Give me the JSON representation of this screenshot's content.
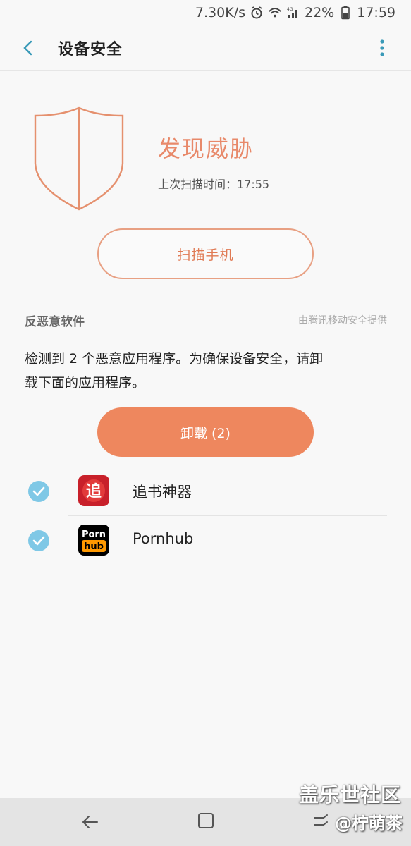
{
  "status_bar": {
    "speed": "7.30K/s",
    "battery": "22%",
    "time": "17:59",
    "icons": [
      "alarm-icon",
      "wifi-icon",
      "signal-4g-icon",
      "battery-icon"
    ]
  },
  "header": {
    "title": "设备安全",
    "back_icon": "chevron-left-icon",
    "more_icon": "more-vertical-icon"
  },
  "threat": {
    "title": "发现威胁",
    "scan_time": "上次扫描时间：17:55",
    "scan_button": "扫描手机",
    "accent_color": "#e8896a"
  },
  "antimalware": {
    "section_label": "反恶意软件",
    "provider": "由腾讯移动安全提供",
    "detect_line1": "检测到 2 个恶意应用程序。为确保设备安全，请卸",
    "detect_line2": "载下面的应用程序。",
    "uninstall_button": "卸载 (2)",
    "apps": [
      {
        "name": "追书神器",
        "icon_text": "追",
        "checked": true
      },
      {
        "name": "Pornhub",
        "icon_text_top": "Porn",
        "icon_text_bottom": "hub",
        "checked": true
      }
    ]
  },
  "watermark": {
    "line1": "盖乐世社区",
    "line2": "@柠萌茶"
  },
  "nav": {
    "back_icon": "nav-back-icon",
    "home_icon": "nav-home-icon",
    "recent_icon": "nav-recent-icon"
  }
}
